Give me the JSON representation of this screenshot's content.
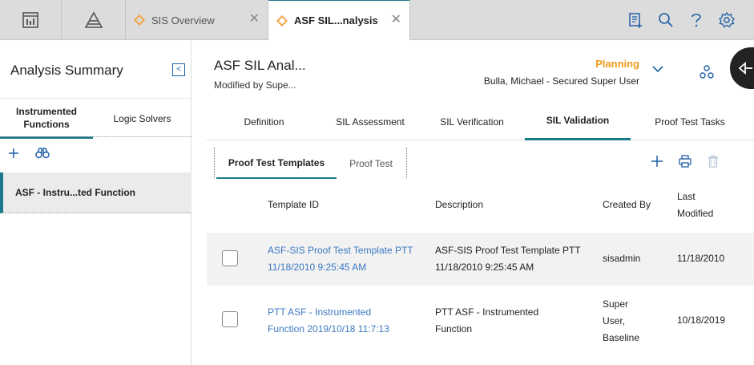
{
  "topbar": {
    "tabs": [
      {
        "label": "SIS Overview",
        "icon": "diamond-icon"
      },
      {
        "label": "ASF SIL...nalysis",
        "icon": "diamond-icon"
      }
    ],
    "close_glyph": "✕",
    "tools": [
      "new-record-icon",
      "search-icon",
      "help-icon",
      "settings-icon"
    ]
  },
  "left_pane": {
    "title": "Analysis Summary",
    "collapse_glyph": "<",
    "tabs": [
      {
        "label": "Instrumented Functions"
      },
      {
        "label": "Logic Solvers"
      }
    ],
    "items": [
      {
        "label": "ASF - Instru...ted Function"
      }
    ]
  },
  "record": {
    "title": "ASF SIL Anal...",
    "modified_by": "Modified by Supe...",
    "state": "Planning",
    "owner": "Bulla, Michael - Secured Super User"
  },
  "main_tabs": [
    {
      "label": "Definition"
    },
    {
      "label": "SIL Assessment"
    },
    {
      "label": "SIL Verification"
    },
    {
      "label": "SIL Validation"
    },
    {
      "label": "Proof Test Tasks"
    }
  ],
  "sub_tabs": [
    {
      "label": "Proof Test Templates"
    },
    {
      "label": "Proof Test"
    }
  ],
  "table": {
    "headers": {
      "template_id": "Template ID",
      "description": "Description",
      "created_by": "Created By",
      "last_modified_1": "Last",
      "last_modified_2": "Modified"
    },
    "rows": [
      {
        "template_id_1": "ASF-SIS Proof Test Template PTT",
        "template_id_2": "11/18/2010 9:25:45 AM",
        "description_1": "ASF-SIS Proof Test Template PTT",
        "description_2": "11/18/2010 9:25:45 AM",
        "created_by_1": "sisadmin",
        "last_modified": "11/18/2010"
      },
      {
        "template_id_1": "PTT ASF - Instrumented",
        "template_id_2": "Function 2019/10/18 11:7:13",
        "description_1": "PTT ASF - Instrumented",
        "description_2": "Function",
        "created_by_1": "Super",
        "created_by_2": "User,",
        "created_by_3": "Baseline",
        "last_modified": "10/18/2019"
      }
    ]
  },
  "colors": {
    "accent": "#1b7a8c",
    "state": "#f29a1c",
    "link": "#3a78c2",
    "icon_blue": "#1e5fa8"
  }
}
